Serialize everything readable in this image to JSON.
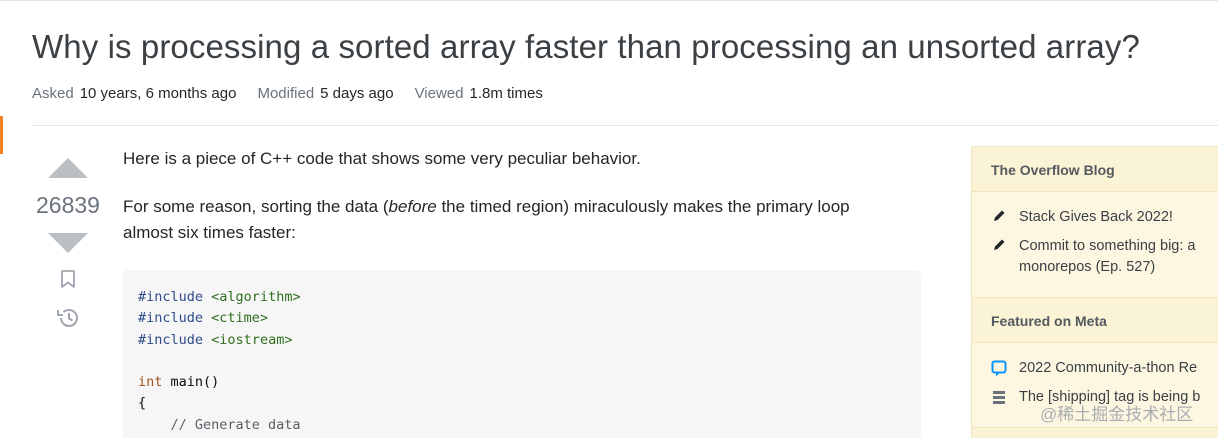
{
  "question": {
    "title": "Why is processing a sorted array faster than processing an unsorted array?",
    "meta": {
      "asked_label": "Asked",
      "asked_value": "10 years, 6 months ago",
      "modified_label": "Modified",
      "modified_value": "5 days ago",
      "viewed_label": "Viewed",
      "viewed_value": "1.8m times"
    },
    "votes": "26839",
    "body": {
      "p1": "Here is a piece of C++ code that shows some very peculiar behavior.",
      "p2_before": "For some reason, sorting the data (",
      "p2_em": "before",
      "p2_after": " the timed region) miraculously makes the primary loop almost six times faster:"
    },
    "code": {
      "line1_kw": "#include",
      "line1_str": "<algorithm>",
      "line2_kw": "#include",
      "line2_str": "<ctime>",
      "line3_kw": "#include",
      "line3_str": "<iostream>",
      "line5_type": "int",
      "line5_rest": " main()",
      "line6": "{",
      "line7": "    // Generate data"
    }
  },
  "sidebar": {
    "blog_header": "The Overflow Blog",
    "blog_items": [
      {
        "icon": "pencil-icon",
        "text": "Stack Gives Back 2022!"
      },
      {
        "icon": "pencil-icon",
        "text": "Commit to something big: a monorepos (Ep. 527)"
      }
    ],
    "meta_header": "Featured on Meta",
    "meta_items": [
      {
        "icon": "speech-bubble-icon",
        "text": "2022 Community-a-thon Re"
      },
      {
        "icon": "stack-exchange-icon",
        "text": "The [shipping] tag is being b"
      }
    ]
  },
  "watermark": "@稀土掘金技术社区",
  "colors": {
    "accent": "#f48225",
    "sidebar_bg": "#fbf3d5",
    "code_bg": "#f6f6f6"
  }
}
